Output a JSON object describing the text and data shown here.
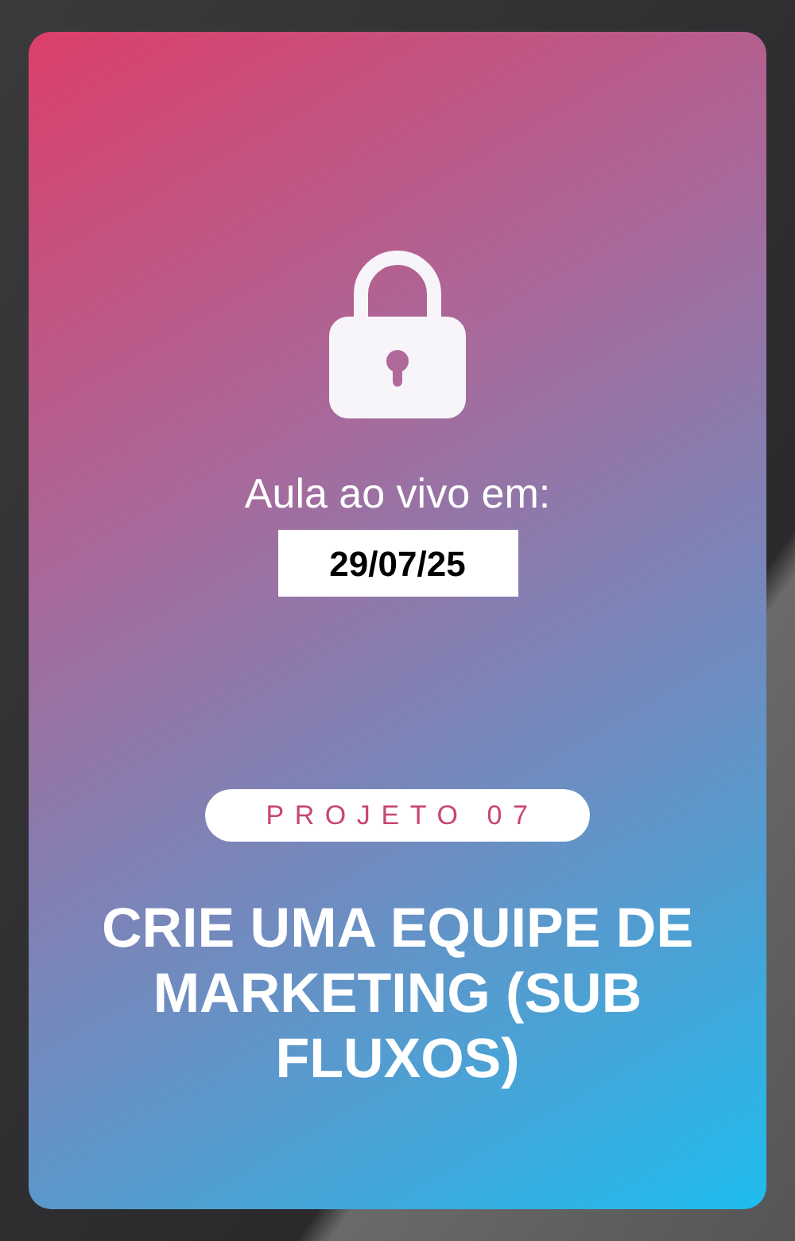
{
  "card": {
    "locked": true,
    "live_label": "Aula ao vivo em:",
    "date": "29/07/25",
    "tag": "PROJETO 07",
    "title": "CRIE UMA EQUIPE DE MARKETING (SUB FLUXOS)"
  }
}
